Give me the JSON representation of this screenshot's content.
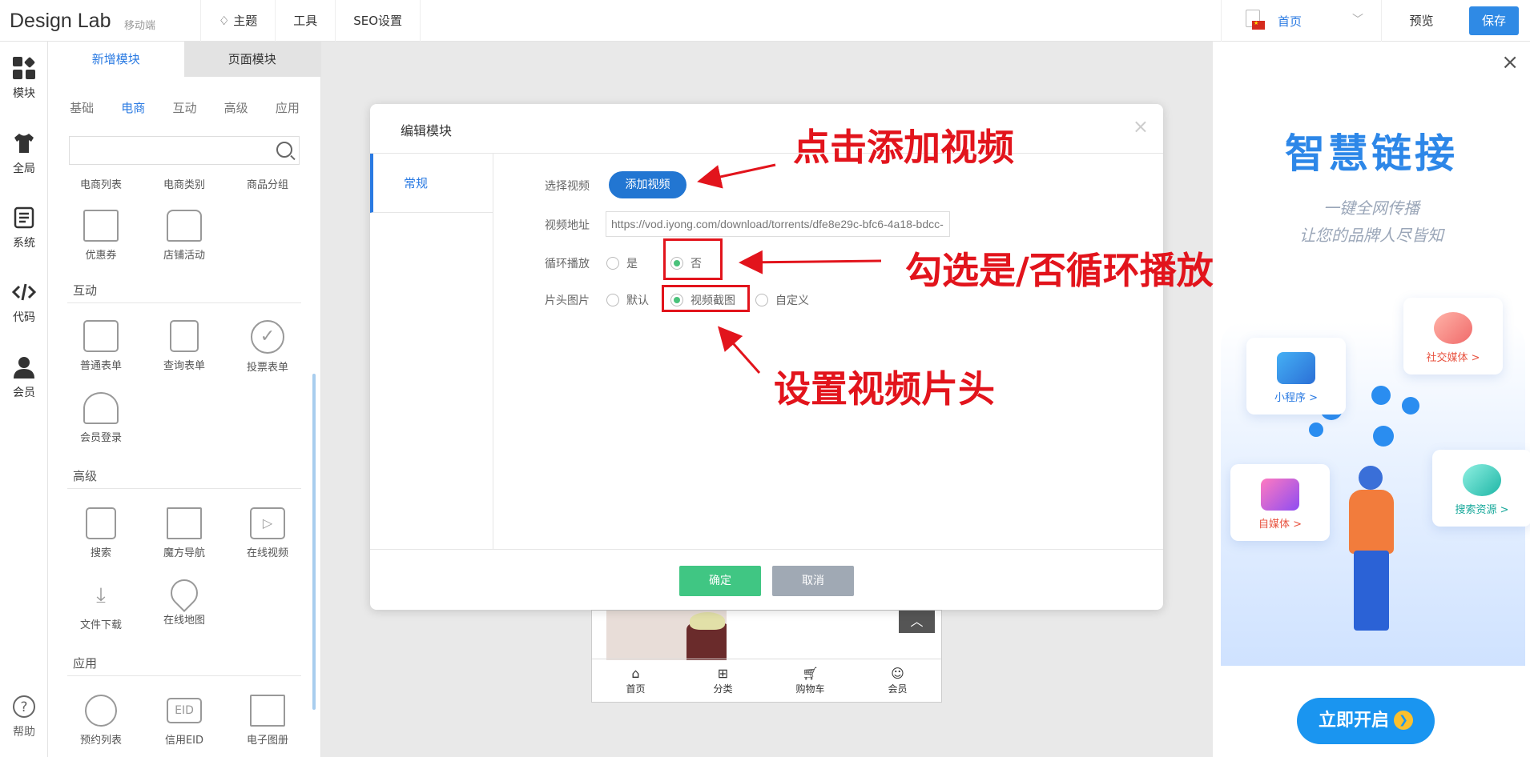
{
  "header": {
    "logo": "Design Lab",
    "mobile_tag": "移动端",
    "nav": [
      "主题",
      "工具",
      "SEO设置"
    ],
    "page_select": "首页",
    "preview": "预览",
    "save": "保存"
  },
  "rail": [
    {
      "label": "模块",
      "icon": "blocks-icon"
    },
    {
      "label": "全局",
      "icon": "shirt-icon"
    },
    {
      "label": "系统",
      "icon": "doc-icon"
    },
    {
      "label": "代码",
      "icon": "code-icon"
    },
    {
      "label": "会员",
      "icon": "user-icon"
    },
    {
      "label": "帮助",
      "icon": "help-icon"
    }
  ],
  "panel": {
    "tabs": [
      "新增模块",
      "页面模块"
    ],
    "subtabs": [
      "基础",
      "电商",
      "互动",
      "高级",
      "应用"
    ],
    "active_subtab": "电商",
    "top_row": [
      "电商列表",
      "电商类别",
      "商品分组"
    ],
    "ecommerce": [
      "优惠券",
      "店铺活动"
    ],
    "sections": {
      "interactive": "互动",
      "advanced": "高级",
      "apps": "应用"
    },
    "interactive_items": [
      "普通表单",
      "查询表单",
      "投票表单",
      "会员登录"
    ],
    "advanced_items": [
      "搜索",
      "魔方导航",
      "在线视频",
      "文件下载",
      "在线地图"
    ],
    "app_items": [
      "预约列表",
      "信用EID",
      "电子图册"
    ]
  },
  "modal": {
    "title": "编辑模块",
    "tab": "常规",
    "select_video_label": "选择视频",
    "add_video_button": "添加视频",
    "video_url_label": "视频地址",
    "video_url": "https://vod.iyong.com/download/torrents/dfe8e29c-bfc6-4a18-bdcc-",
    "loop_label": "循环播放",
    "loop_options": [
      "是",
      "否"
    ],
    "loop_selected": "否",
    "cover_label": "片头图片",
    "cover_options": [
      "默认",
      "视频截图",
      "自定义"
    ],
    "cover_selected": "视频截图",
    "ok": "确定",
    "cancel": "取消"
  },
  "annotations": {
    "add_video": "点击添加视频",
    "loop": "勾选是/否循环播放",
    "cover": "设置视频片头"
  },
  "phone": {
    "nav": [
      "首页",
      "分类",
      "购物车",
      "会员"
    ],
    "up": "︿"
  },
  "promo": {
    "title": "智慧链接",
    "sub1": "一键全网传播",
    "sub2": "让您的品牌人尽皆知",
    "cards": [
      "小程序 >",
      "社交媒体 >",
      "自媒体 >",
      "搜索资源 >"
    ],
    "open": "立即开启"
  },
  "colors": {
    "accent": "#2a7ae2",
    "annotation_red": "#e2141c",
    "ok_green": "#40c683",
    "cancel_gray": "#a0a9b4"
  }
}
